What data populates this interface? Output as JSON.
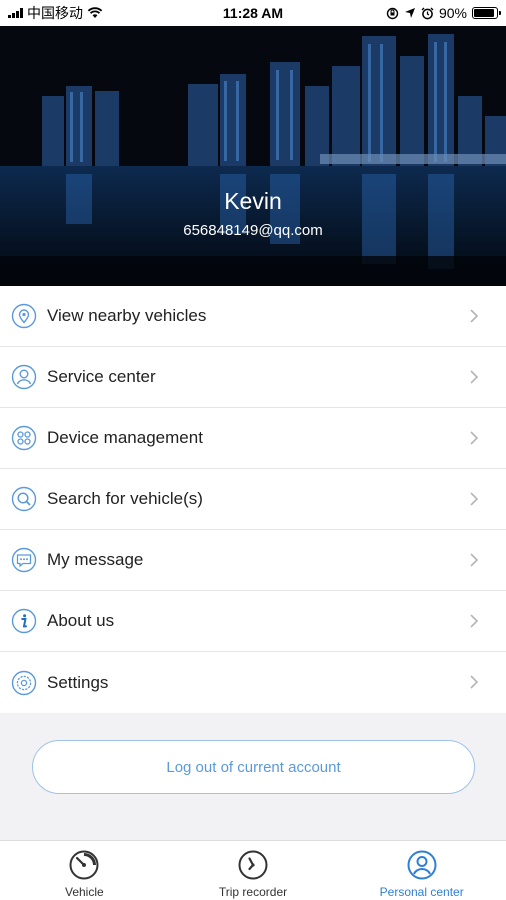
{
  "status_bar": {
    "carrier": "中国移动",
    "time": "11:28 AM",
    "battery": "90%",
    "battery_level": 0.9
  },
  "profile": {
    "name": "Kevin",
    "email": "656848149@qq.com"
  },
  "menu": {
    "items": [
      {
        "label": "View nearby vehicles",
        "icon": "location-pin-icon"
      },
      {
        "label": "Service center",
        "icon": "person-icon"
      },
      {
        "label": "Device management",
        "icon": "device-grid-icon"
      },
      {
        "label": "Search for vehicle(s)",
        "icon": "search-icon"
      },
      {
        "label": "My message",
        "icon": "message-icon"
      },
      {
        "label": "About us",
        "icon": "info-icon"
      },
      {
        "label": "Settings",
        "icon": "settings-icon"
      }
    ]
  },
  "logout": {
    "label": "Log out of current account"
  },
  "tabs": {
    "items": [
      {
        "label": "Vehicle",
        "icon": "speedometer-icon"
      },
      {
        "label": "Trip recorder",
        "icon": "clock-icon"
      },
      {
        "label": "Personal center",
        "icon": "person-icon"
      }
    ],
    "active_index": 2
  },
  "colors": {
    "accent": "#2f7fd6",
    "icon_blue": "#5b9ad9",
    "background": "#f2f2f4"
  }
}
